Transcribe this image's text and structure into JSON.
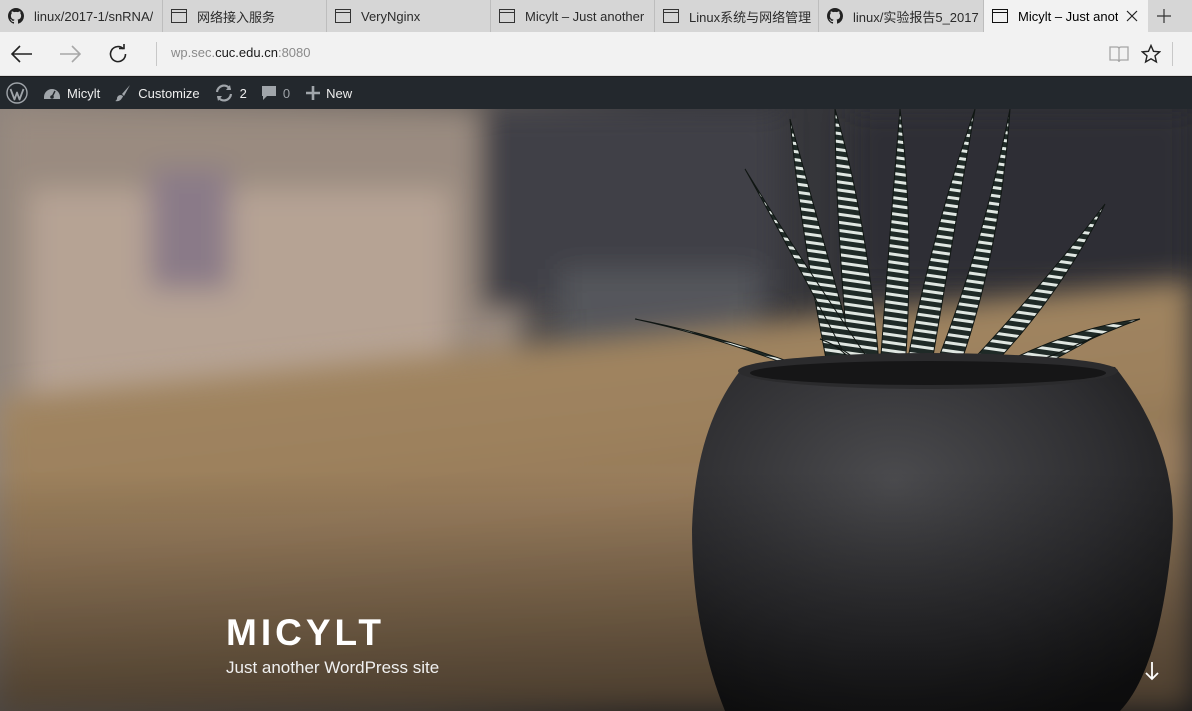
{
  "tabs": [
    {
      "title": "linux/2017-1/snRNA/",
      "icon": "github-icon",
      "active": false
    },
    {
      "title": "网络接入服务",
      "icon": "page-icon",
      "active": false
    },
    {
      "title": "VeryNginx",
      "icon": "page-icon",
      "active": false
    },
    {
      "title": "Micylt – Just another",
      "icon": "page-icon",
      "active": false
    },
    {
      "title": "Linux系统与网络管理",
      "icon": "page-icon",
      "active": false
    },
    {
      "title": "linux/实验报告5_2017",
      "icon": "github-icon",
      "active": false
    },
    {
      "title": "Micylt – Just anot",
      "icon": "page-icon",
      "active": true
    }
  ],
  "address": {
    "prefix": "wp.sec.",
    "host": "cuc.edu.cn",
    "port": ":8080"
  },
  "admin_bar": {
    "site_name": "Micylt",
    "customize": "Customize",
    "updates_count": "2",
    "comments_count": "0",
    "new_label": "New"
  },
  "hero": {
    "site_title": "MICYLT",
    "tagline": "Just another WordPress site"
  },
  "colors": {
    "tabstrip": "#d6d6d6",
    "active_tab": "#f2f2f2",
    "admin_bar": "#23282d"
  }
}
